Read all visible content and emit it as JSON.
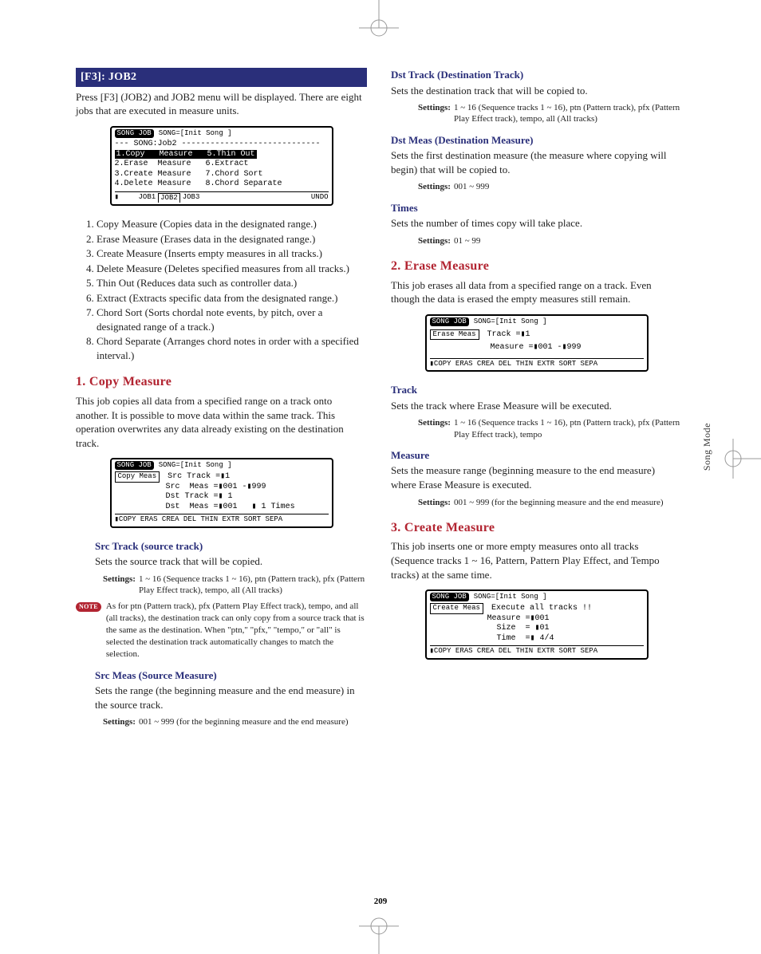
{
  "page_number": "209",
  "side_tab": "Song Mode",
  "header_bar": "[F3]: JOB2",
  "intro_para": "Press [F3] (JOB2) and JOB2 menu will be displayed. There are eight jobs that are executed in measure units.",
  "screen_menu": {
    "title": "SONG JOB",
    "right": "SONG=[Init Song ]",
    "sub": "--- SONG:Job2 -----------------------------",
    "rows": [
      "1.Copy   Measure   5.Thin Out",
      "2.Erase  Measure   6.Extract",
      "3.Create Measure   7.Chord Sort",
      "4.Delete Measure   8.Chord Separate"
    ],
    "tabs_left": "JOB1",
    "tabs_mid": "JOB2",
    "tabs_right": "JOB3",
    "undo": "UNDO"
  },
  "job_list": [
    "Copy Measure (Copies data in the designated range.)",
    "Erase Measure (Erases data in the designated range.)",
    "Create Measure (Inserts empty measures in all tracks.)",
    "Delete Measure (Deletes specified measures from all tracks.)",
    "Thin Out (Reduces data such as controller data.)",
    "Extract (Extracts specific data from the designated range.)",
    "Chord Sort (Sorts chordal note events, by pitch, over a designated range of a track.)",
    "Chord Separate (Arranges chord notes in order with a specified interval.)"
  ],
  "copy_measure": {
    "heading": "1. Copy Measure",
    "desc": "This job copies all data from a specified range on a track onto another. It is possible to move data within the same track. This operation overwrites any data already existing on the destination track.",
    "screen": {
      "title": "SONG JOB",
      "right": "SONG=[Init Song ]",
      "box": "Copy Meas",
      "lines": [
        "Src Track =▮1  ",
        "Src  Meas =▮001 -▮999",
        "Dst Track =▮ 1",
        "Dst  Meas =▮001   ▮ 1 Times"
      ],
      "tabs": "▮COPY ERAS CREA DEL THIN EXTR SORT SEPA"
    },
    "src_track": {
      "heading": "Src Track (source track)",
      "desc": "Sets the source track that will be copied.",
      "settings_label": "Settings:",
      "settings_value": "1 ~ 16 (Sequence tracks 1 ~ 16), ptn (Pattern track), pfx (Pattern Play Effect track), tempo, all (All tracks)"
    },
    "note_badge": "NOTE",
    "note_text": "As for ptn (Pattern track), pfx (Pattern Play Effect track), tempo, and all (all tracks), the destination track can only copy from a source track that is the same as the destination. When \"ptn,\" \"pfx,\" \"tempo,\" or \"all\" is selected the destination track automatically changes to match the selection.",
    "src_meas": {
      "heading": "Src Meas (Source Measure)",
      "desc": "Sets the range (the beginning measure and the end measure) in the source track.",
      "settings_label": "Settings:",
      "settings_value": "001 ~ 999 (for the beginning measure and the end measure)"
    }
  },
  "dst_track": {
    "heading": "Dst Track (Destination Track)",
    "desc": "Sets the destination track that will be copied to.",
    "settings_label": "Settings:",
    "settings_value": "1 ~ 16 (Sequence tracks 1 ~ 16), ptn (Pattern track), pfx (Pattern Play Effect track), tempo, all (All tracks)"
  },
  "dst_meas": {
    "heading": "Dst Meas (Destination Measure)",
    "desc": "Sets the first destination measure (the measure where copying will begin) that will be copied to.",
    "settings_label": "Settings:",
    "settings_value": "001 ~ 999"
  },
  "times": {
    "heading": "Times",
    "desc": "Sets the number of times copy will take place.",
    "settings_label": "Settings:",
    "settings_value": "01 ~ 99"
  },
  "erase_measure": {
    "heading": "2. Erase Measure",
    "desc": "This job erases all data from a specified range on a track. Even though the data is erased the empty measures still remain.",
    "screen": {
      "title": "SONG JOB",
      "right": "SONG=[Init Song ]",
      "box": "Erase Meas",
      "lines": [
        "Track =▮1  ",
        "Measure =▮001 -▮999"
      ],
      "tabs": "▮COPY ERAS CREA DEL THIN EXTR SORT SEPA"
    },
    "track": {
      "heading": "Track",
      "desc": "Sets the track where Erase Measure will be executed.",
      "settings_label": "Settings:",
      "settings_value": "1 ~ 16 (Sequence tracks 1 ~ 16), ptn (Pattern track), pfx (Pattern Play Effect track), tempo"
    },
    "measure_param": {
      "heading": "Measure",
      "desc": "Sets the measure range (beginning measure to the end measure) where Erase Measure is executed.",
      "settings_label": "Settings:",
      "settings_value": "001 ~ 999 (for the beginning measure and the end measure)"
    }
  },
  "create_measure": {
    "heading": "3. Create Measure",
    "desc": "This job inserts one or more empty measures onto all tracks (Sequence tracks 1 ~ 16, Pattern, Pattern Play Effect, and Tempo tracks) at the same time.",
    "screen": {
      "title": "SONG JOB",
      "right": "SONG=[Init Song ]",
      "box": "Create Meas",
      "line0": "Execute all tracks !!",
      "lines": [
        "Measure =▮001",
        "  Size  = ▮01",
        "  Time  =▮ 4/4"
      ],
      "tabs": "▮COPY ERAS CREA DEL THIN EXTR SORT SEPA"
    }
  }
}
